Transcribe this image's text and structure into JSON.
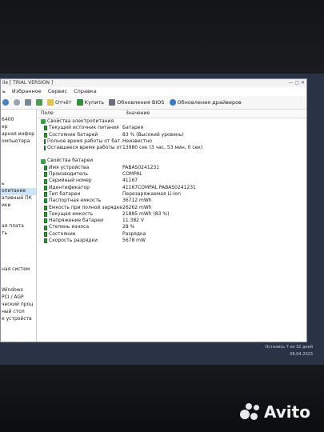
{
  "window": {
    "title": "ile [ TRIAL VERSION ]",
    "menu": [
      "ь",
      "Избранное",
      "Сервис",
      "Справка"
    ],
    "toolbar": {
      "report": "Отчёт",
      "buy": "Купить",
      "bios_update": "Обновления BIOS",
      "driver_update": "Обновления драйверов"
    }
  },
  "left_panel": [
    "",
    "6400",
    "ер",
    "арная инфор",
    "омпьютера",
    "",
    "",
    "",
    "",
    "",
    "ь",
    "опитание",
    "ативный ПК",
    "ики",
    "",
    "",
    "ая плата",
    "ть",
    "",
    "",
    "",
    "",
    "ная систем",
    "",
    "",
    "Windows",
    "PCI / AGP",
    "ческий проц",
    "ный стол",
    "е устройств",
    "",
    "",
    "",
    "",
    "",
    "",
    "",
    "",
    "",
    "",
    "",
    "",
    "",
    "",
    "",
    "",
    ""
  ],
  "columns": {
    "field": "Поле",
    "value": "Значение"
  },
  "groups": [
    {
      "title": "Свойства электропитания",
      "rows": [
        {
          "field": "Текущий источник питания",
          "value": "Батарея"
        },
        {
          "field": "Состояние батарей",
          "value": "83 % (Высокий уровень)"
        },
        {
          "field": "Полное время работы от бат...",
          "value": "Неизвестно"
        },
        {
          "field": "Оставшееся время работы от...",
          "value": "13980 сек (3 час, 53 мин, 0 сек)"
        }
      ]
    },
    {
      "title": "Свойства батареи",
      "rows": [
        {
          "field": "Имя устройства",
          "value": "PABAS0241231"
        },
        {
          "field": "Производитель",
          "value": "COMPAL"
        },
        {
          "field": "Серийный номер",
          "value": "41167"
        },
        {
          "field": "Идентификатор",
          "value": "41167COMPAL PABAS0241231"
        },
        {
          "field": "Тип батареи",
          "value": "Перезаряжаемая Li-Ion"
        },
        {
          "field": "Паспортная емкость",
          "value": "36712 mWh"
        },
        {
          "field": "Емкость при полной зарядке",
          "value": "26262 mWh"
        },
        {
          "field": "Текущая емкость",
          "value": "21885 mWh (83 %)"
        },
        {
          "field": "Напряжение батареи",
          "value": "11.382 V"
        },
        {
          "field": "Степень износа",
          "value": "28 %"
        },
        {
          "field": "Состояние",
          "value": "Разрядка"
        },
        {
          "field": "Скорость разрядки",
          "value": "5678 mW"
        }
      ]
    }
  ],
  "desktop": {
    "notice": "Остались 7 из 32 дней",
    "date": "06.04.2023"
  },
  "watermark": {
    "brand": "Avito"
  }
}
